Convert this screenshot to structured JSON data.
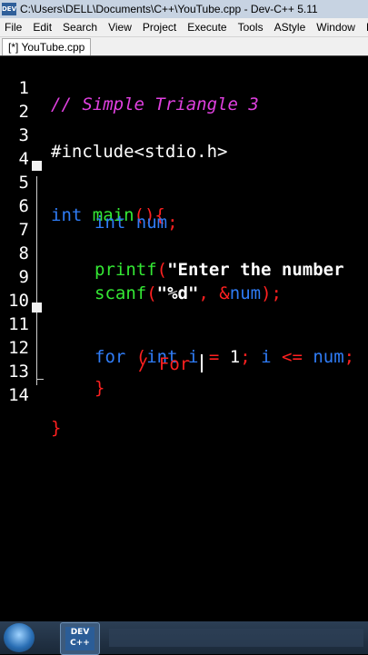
{
  "window": {
    "title": "C:\\Users\\DELL\\Documents\\C++\\YouTube.cpp - Dev-C++ 5.11",
    "app_icon_text": "DEV"
  },
  "menu": [
    "File",
    "Edit",
    "Search",
    "View",
    "Project",
    "Execute",
    "Tools",
    "AStyle",
    "Window",
    "Help"
  ],
  "tab": {
    "label": "[*] YouTube.cpp"
  },
  "editor": {
    "line_numbers": [
      "1",
      "2",
      "3",
      "4",
      "5",
      "6",
      "7",
      "8",
      "9",
      "10",
      "11",
      "12",
      "13",
      "14"
    ],
    "line1": "// Simple Triangle 3",
    "line3": "#include<stdio.h>",
    "line5_kw": "int",
    "line5_fn": "main",
    "line5_sym": "(){",
    "line6_kw": "int",
    "line6_id": "num",
    "line6_sym": ";",
    "line8_fn": "printf",
    "line8_sym": "(",
    "line8_str": "\"Enter the number",
    "line9_fn": "scanf",
    "line9_sym1": "(",
    "line9_str": "\"%d\"",
    "line9_sym2": ", &",
    "line9_id": "num",
    "line9_sym3": ");",
    "line11_kw": "for",
    "line11_sym1": " (",
    "line11_kw2": "int",
    "line11_id1": " i ",
    "line11_sym2": "=",
    "line11_num": " 1",
    "line11_sym3": ";",
    "line11_id2": " i ",
    "line11_sym4": "<=",
    "line11_id3": " num",
    "line11_sym5": ";",
    "line12": "/ For ",
    "line13": "}",
    "line14": "}"
  },
  "taskbar": {
    "devcpp_icon_text": "DEV C++"
  }
}
